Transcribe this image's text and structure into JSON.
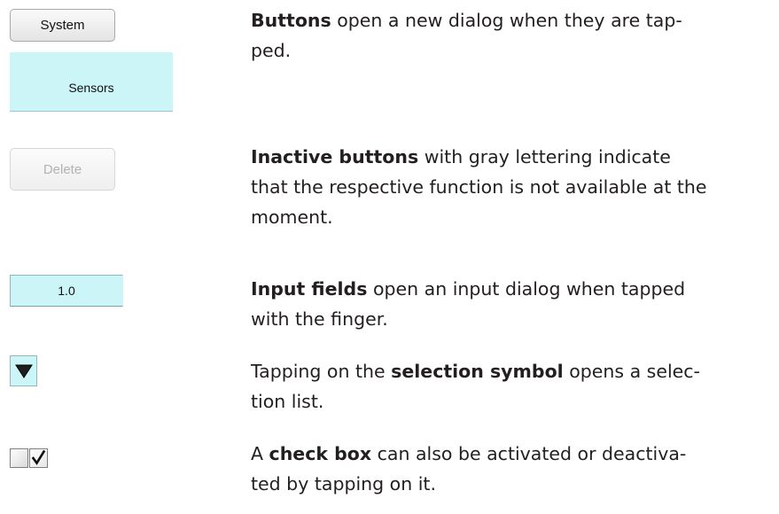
{
  "controls": {
    "system_button": "System",
    "sensors_button": "Sensors",
    "delete_button": "Delete",
    "input_value": "1.0",
    "selection_icon": "triangle-down-icon",
    "checkbox_states": [
      "unchecked",
      "checked"
    ]
  },
  "descriptions": {
    "buttons": {
      "term": "Buttons",
      "line1_rest": " open a new dialog when they are tap-",
      "line2": "ped."
    },
    "inactive": {
      "term": "Inactive buttons",
      "line1_rest": " with gray lettering indicate",
      "line2": "that the respective function is not available at the",
      "line3": "moment."
    },
    "input": {
      "term": "Input fields",
      "line1_rest": " open an input dialog when tapped",
      "line2": "with the finger."
    },
    "selection": {
      "line1_pre": "Tapping on the ",
      "term": "selection symbol",
      "line1_rest": " opens a selec-",
      "line2": "tion list."
    },
    "checkbox": {
      "line1_pre": "A ",
      "term": "check box",
      "line1_rest": " can also be activated or deactiva-",
      "line2": "ted by tapping on it."
    }
  },
  "colors": {
    "accent_cyan": "#ccf5f8",
    "inactive_text": "#b2b2b2",
    "body_text": "#231f20"
  }
}
